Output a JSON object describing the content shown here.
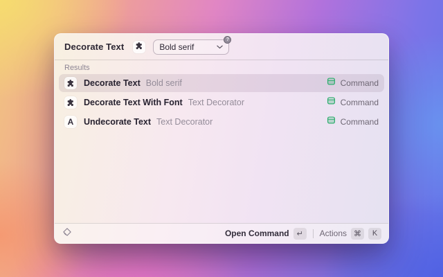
{
  "header": {
    "title": "Decorate Text",
    "dropdown": {
      "value": "Bold serif",
      "badge": "?"
    }
  },
  "results": {
    "label": "Results",
    "rows": [
      {
        "title": "Decorate Text",
        "subtitle": "Bold serif",
        "accessory": "Command",
        "selected": true
      },
      {
        "title": "Decorate Text With Font",
        "subtitle": "Text Decorator",
        "accessory": "Command",
        "selected": false
      },
      {
        "title": "Undecorate Text",
        "subtitle": "Text Decorator",
        "accessory": "Command",
        "selected": false
      }
    ]
  },
  "footer": {
    "open_command_label": "Open Command",
    "return_key": "↵",
    "actions_label": "Actions",
    "cmd_key": "⌘",
    "k_key": "K"
  },
  "icons": {
    "letter_a": "A",
    "extension_icon": "puzzle-icon",
    "accessory_icon": "command-window-icon",
    "footer_icon": "raycast-logo-icon"
  },
  "colors": {
    "accent_green": "#2fae6e",
    "selection_tint": "rgba(78,44,74,0.10)"
  }
}
